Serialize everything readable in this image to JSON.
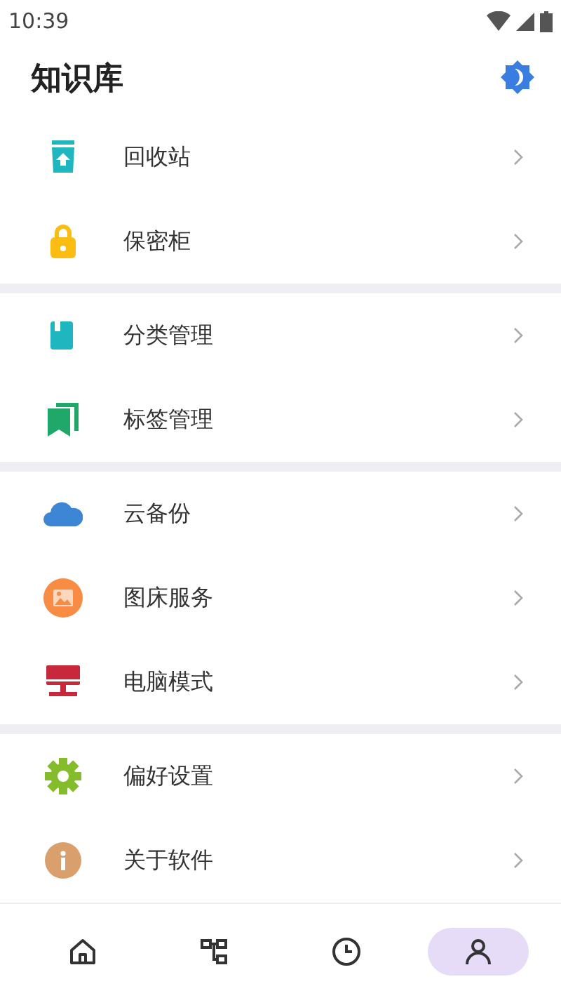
{
  "status_bar": {
    "time": "10:39"
  },
  "header": {
    "title": "知识库"
  },
  "groups": [
    {
      "items": [
        {
          "label": "回收站"
        },
        {
          "label": "保密柜"
        }
      ]
    },
    {
      "items": [
        {
          "label": "分类管理"
        },
        {
          "label": "标签管理"
        }
      ]
    },
    {
      "items": [
        {
          "label": "云备份"
        },
        {
          "label": "图床服务"
        },
        {
          "label": "电脑模式"
        }
      ]
    },
    {
      "items": [
        {
          "label": "偏好设置"
        },
        {
          "label": "关于软件"
        }
      ]
    }
  ],
  "bottom_nav": [
    {
      "selected": false
    },
    {
      "selected": false
    },
    {
      "selected": false
    },
    {
      "selected": true
    }
  ]
}
